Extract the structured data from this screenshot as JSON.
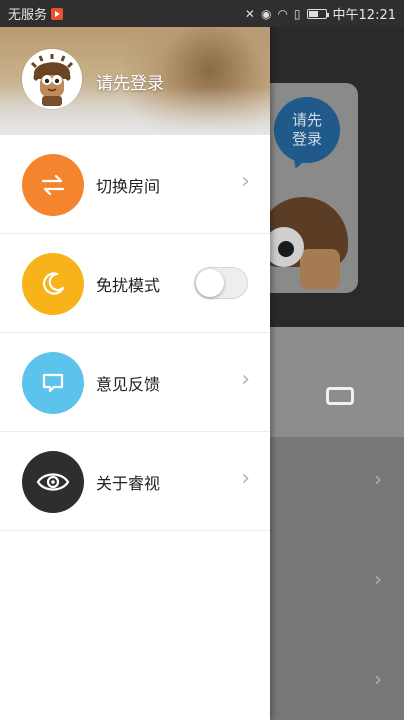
{
  "status_bar": {
    "carrier": "无服务",
    "time": "中午12:21"
  },
  "drawer": {
    "header": {
      "login_text": "请先登录"
    },
    "menu": [
      {
        "label": "切换房间",
        "icon": "swap-icon",
        "color": "#F4852E",
        "control": "chevron"
      },
      {
        "label": "免扰模式",
        "icon": "moon-icon",
        "color": "#F9B31A",
        "control": "toggle",
        "toggle_on": false
      },
      {
        "label": "意见反馈",
        "icon": "message-icon",
        "color": "#5CC4EC",
        "control": "chevron"
      },
      {
        "label": "关于睿视",
        "icon": "eye-icon",
        "color": "#2E2E2E",
        "control": "chevron"
      }
    ]
  },
  "background": {
    "bubble_text": "请先登录"
  }
}
